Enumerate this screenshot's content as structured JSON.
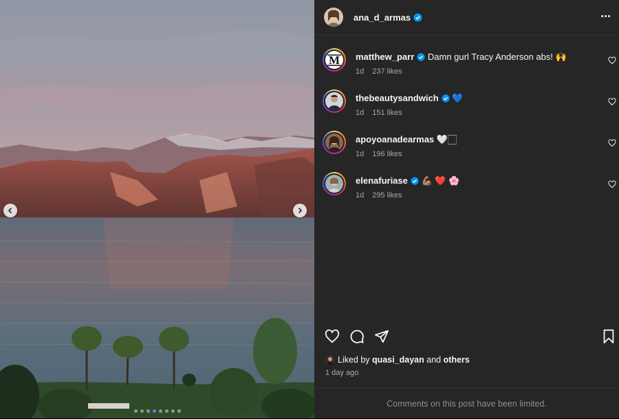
{
  "post": {
    "author": {
      "username": "ana_d_armas",
      "verified": true
    },
    "more_icon": "more-horizontal-icon",
    "carousel": {
      "slide_count": 8,
      "active_index": 3
    },
    "comments": [
      {
        "username": "matthew_parr",
        "verified": true,
        "text": "Damn gurl Tracy Anderson abs! 🙌",
        "age": "1d",
        "likes": "237 likes"
      },
      {
        "username": "thebeautysandwich",
        "verified": true,
        "text": "💙",
        "age": "1d",
        "likes": "151 likes"
      },
      {
        "username": "apoyoanadearmas",
        "verified": false,
        "text": "🤍🏻",
        "age": "1d",
        "likes": "196 likes"
      },
      {
        "username": "elenafuriase",
        "verified": true,
        "text": "💪🏽 ❤️ 🌸",
        "age": "1d",
        "likes": "295 likes"
      }
    ],
    "liked_by": {
      "prefix": "Liked by",
      "user": "quasi_dayan",
      "conj": "and",
      "others": "others"
    },
    "timestamp": "1 day ago",
    "comments_limited": "Comments on this post have been limited."
  },
  "colors": {
    "panel_bg": "#262626",
    "verified": "#0095f6",
    "muted": "#a8a8a8"
  }
}
